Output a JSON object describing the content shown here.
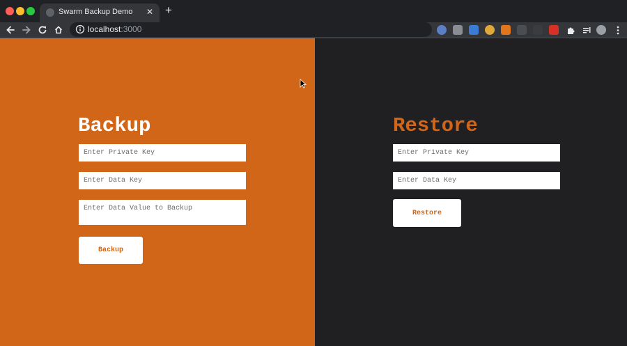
{
  "browser": {
    "tab_title": "Swarm Backup Demo",
    "url_host": "localhost",
    "url_port": ":3000"
  },
  "backup": {
    "heading": "Backup",
    "private_key_placeholder": "Enter Private Key",
    "data_key_placeholder": "Enter Data Key",
    "data_value_placeholder": "Enter Data Value to Backup",
    "button_label": "Backup"
  },
  "restore": {
    "heading": "Restore",
    "private_key_placeholder": "Enter Private Key",
    "data_key_placeholder": "Enter Data Key",
    "button_label": "Restore"
  },
  "colors": {
    "accent_orange": "#d16518",
    "dark_background": "#202023",
    "white": "#ffffff"
  },
  "icons": {
    "back": "back-arrow-icon",
    "forward": "forward-arrow-icon",
    "reload": "reload-icon",
    "home": "home-icon",
    "info": "info-icon",
    "bookmark": "star-icon",
    "menu": "kebab-menu-icon"
  }
}
